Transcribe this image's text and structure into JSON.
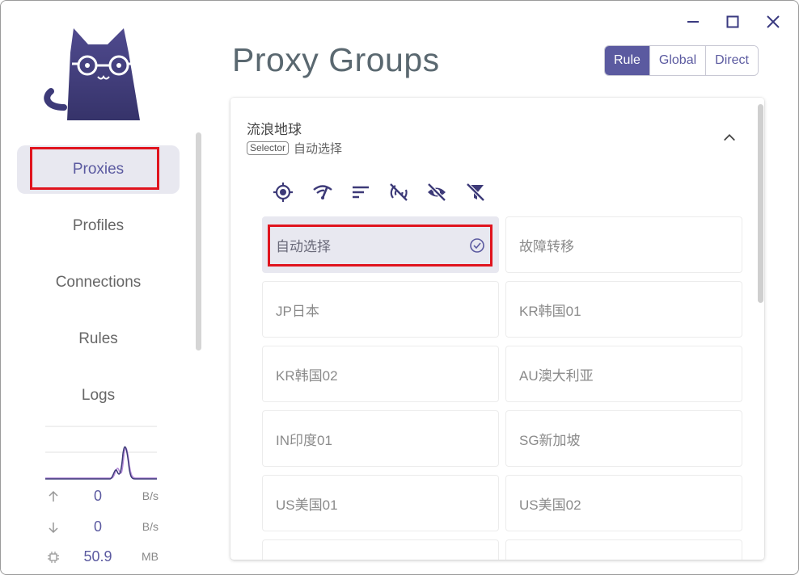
{
  "window": {
    "controls": [
      "minimize",
      "maximize",
      "close"
    ]
  },
  "sidebar": {
    "items": [
      {
        "label": "Proxies",
        "active": true
      },
      {
        "label": "Profiles",
        "active": false
      },
      {
        "label": "Connections",
        "active": false
      },
      {
        "label": "Rules",
        "active": false
      },
      {
        "label": "Logs",
        "active": false
      }
    ],
    "stats": {
      "upload": {
        "value": "0",
        "unit": "B/s"
      },
      "download": {
        "value": "0",
        "unit": "B/s"
      },
      "memory": {
        "value": "50.9",
        "unit": "MB"
      }
    }
  },
  "main": {
    "title": "Proxy Groups",
    "modes": [
      {
        "label": "Rule",
        "active": true
      },
      {
        "label": "Global",
        "active": false
      },
      {
        "label": "Direct",
        "active": false
      }
    ],
    "group": {
      "name": "流浪地球",
      "type": "Selector",
      "current": "自动选择",
      "proxies": [
        "自动选择",
        "故障转移",
        "JP日本",
        "KR韩国01",
        "KR韩国02",
        "AU澳大利亚",
        "IN印度01",
        "SG新加坡",
        "US美国01",
        "US美国02"
      ]
    }
  },
  "colors": {
    "accent": "#5b5aa0",
    "highlight": "#e0141e",
    "selected_bg": "#e8e8f0"
  }
}
